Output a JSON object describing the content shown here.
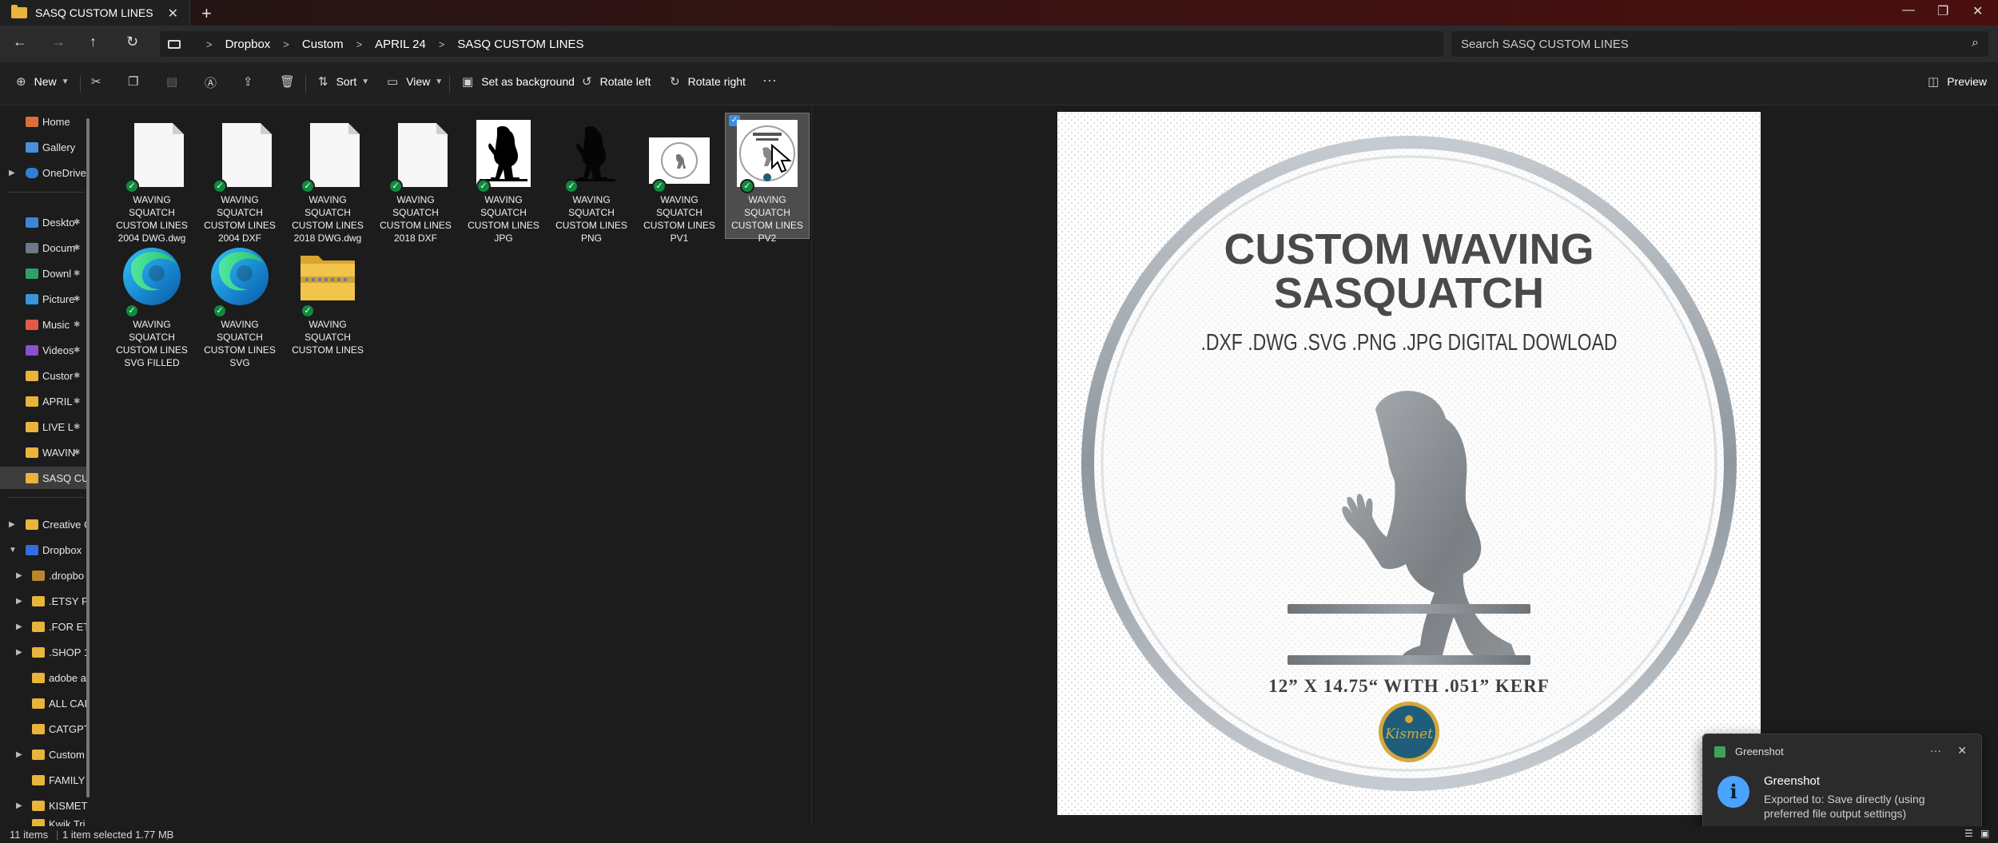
{
  "window": {
    "tab_title": "SASQ CUSTOM LINES",
    "new_tab": "+",
    "tab_close": "✕",
    "minimize": "—",
    "maximize": "❐",
    "close": "✕"
  },
  "nav": {
    "back": "←",
    "forward": "→",
    "up": "↑",
    "refresh": "↻",
    "breadcrumb": [
      "Dropbox",
      "Custom",
      "APRIL 24",
      "SASQ CUSTOM LINES"
    ],
    "search_placeholder": "Search SASQ CUSTOM LINES"
  },
  "commands": {
    "new": "New",
    "sort": "Sort",
    "view": "View",
    "set_background": "Set as background",
    "rotate_left": "Rotate left",
    "rotate_right": "Rotate right",
    "more": "···",
    "preview": "Preview"
  },
  "sidebar": {
    "home": "Home",
    "gallery": "Gallery",
    "onedrive": "OneDrive",
    "pinned": [
      "Deskto",
      "Docum",
      "Downl",
      "Picture",
      "Music",
      "Videos",
      "Custor",
      "APRIL",
      "LIVE L",
      "WAVIN",
      "SASQ CU"
    ],
    "creative": "Creative C",
    "dropbox": "Dropbox",
    "dropbox_children": [
      ".dropbo",
      ".ETSY FI",
      ".FOR ET",
      ".SHOP 1",
      "adobe a",
      "ALL CAI",
      "CATGPT",
      "Custom",
      "FAMILY",
      "KISMET",
      "Kwik Tri"
    ]
  },
  "files": [
    {
      "name": "WAVING SQUATCH CUSTOM LINES 2004 DWG.dwg",
      "type": "doc"
    },
    {
      "name": "WAVING SQUATCH CUSTOM LINES 2004 DXF",
      "type": "doc"
    },
    {
      "name": "WAVING SQUATCH CUSTOM LINES 2018 DWG.dwg",
      "type": "doc"
    },
    {
      "name": "WAVING SQUATCH CUSTOM LINES 2018 DXF",
      "type": "doc"
    },
    {
      "name": "WAVING SQUATCH CUSTOM LINES JPG",
      "type": "jpg"
    },
    {
      "name": "WAVING SQUATCH CUSTOM LINES PNG",
      "type": "png"
    },
    {
      "name": "WAVING SQUATCH CUSTOM LINES PV1",
      "type": "pv1"
    },
    {
      "name": "WAVING SQUATCH CUSTOM LINES PV2",
      "type": "pv2"
    },
    {
      "name": "WAVING SQUATCH CUSTOM LINES SVG FILLED",
      "type": "edge"
    },
    {
      "name": "WAVING SQUATCH CUSTOM LINES SVG",
      "type": "edge"
    },
    {
      "name": "WAVING SQUATCH CUSTOM LINES",
      "type": "zip"
    }
  ],
  "preview": {
    "title_line1": "CUSTOM WAVING",
    "title_line2": "SASQUATCH",
    "formats": ".DXF .DWG .SVG .PNG .JPG DIGITAL DOWLOAD",
    "size": "12” X 14.75“ WITH .051” KERF",
    "logo": "Kismet"
  },
  "toast": {
    "app": "Greenshot",
    "more": "···",
    "close": "✕",
    "heading": "Greenshot",
    "body": "Exported to: Save directly (using preferred file output settings)"
  },
  "status": {
    "items": "11 items",
    "selected": "1 item selected  1.77 MB"
  },
  "colors": {
    "check_green": "#0f8a3a",
    "accent": "#3a8fe6",
    "info_blue": "#4aa3ff"
  }
}
